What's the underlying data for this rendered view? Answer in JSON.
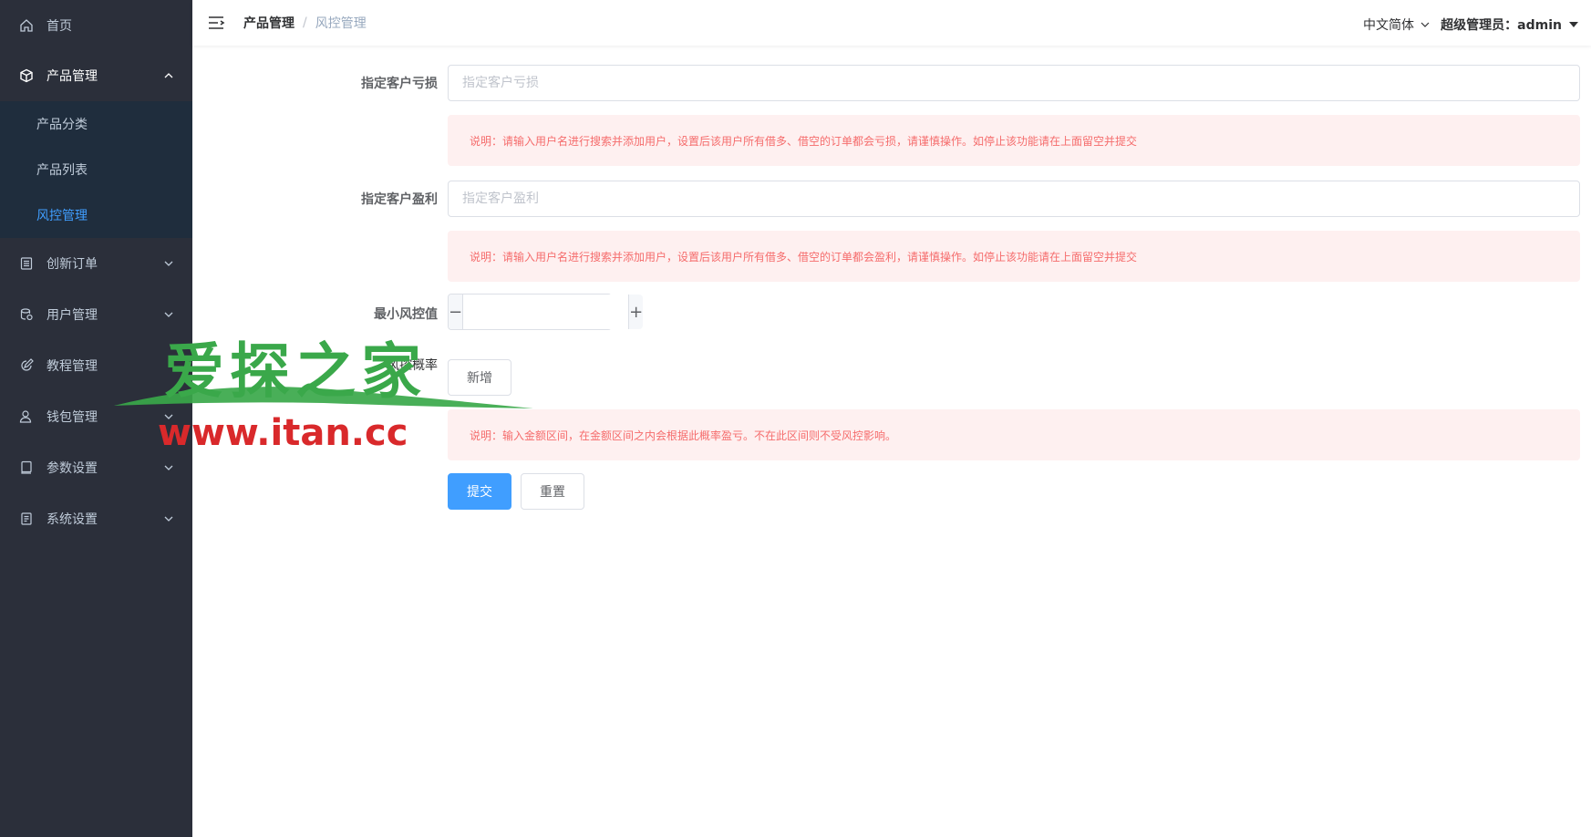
{
  "sidebar": {
    "items": [
      {
        "label": "首页",
        "icon": "home-icon"
      },
      {
        "label": "产品管理",
        "icon": "cube-icon",
        "open": true,
        "children": [
          "产品分类",
          "产品列表",
          "风控管理"
        ],
        "active_child": "风控管理"
      },
      {
        "label": "创新订单",
        "icon": "list-icon"
      },
      {
        "label": "用户管理",
        "icon": "users-icon"
      },
      {
        "label": "教程管理",
        "icon": "edit-icon"
      },
      {
        "label": "钱包管理",
        "icon": "user-icon"
      },
      {
        "label": "参数设置",
        "icon": "book-icon"
      },
      {
        "label": "系统设置",
        "icon": "document-icon"
      }
    ]
  },
  "header": {
    "breadcrumb": [
      "产品管理",
      "风控管理"
    ],
    "language": "中文简体",
    "user": "超级管理员：admin"
  },
  "form": {
    "loss": {
      "label": "指定客户亏损",
      "placeholder": "指定客户亏损",
      "note": "说明：请输入用户名进行搜索并添加用户，设置后该用户所有借多、借空的订单都会亏损，请谨慎操作。如停止该功能请在上面留空并提交"
    },
    "profit": {
      "label": "指定客户盈利",
      "placeholder": "指定客户盈利",
      "note": "说明：请输入用户名进行搜索并添加用户，设置后该用户所有借多、借空的订单都会盈利，请谨慎操作。如停止该功能请在上面留空并提交"
    },
    "min_value": {
      "label": "最小风控值",
      "minus": "−",
      "plus": "+",
      "value": ""
    },
    "probability": {
      "label": "风控概率",
      "add_label": "新增",
      "note": "说明：输入金额区间，在金额区间之内会根据此概率盈亏。不在此区间则不受风控影响。"
    },
    "submit": "提交",
    "reset": "重置"
  },
  "watermark": {
    "line1": "爱探之家",
    "line2": "www.itan.cc"
  },
  "colors": {
    "sidebar_bg": "#2b2f3a",
    "submenu_bg": "#1f2d3d",
    "active": "#409eff",
    "danger": "#f56c6c",
    "alert_bg": "#fef0f0"
  }
}
